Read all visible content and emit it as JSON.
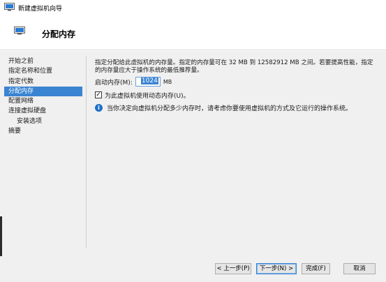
{
  "window": {
    "title": "新建虚拟机向导"
  },
  "header": {
    "title": "分配内存"
  },
  "nav": {
    "items": [
      {
        "label": "开始之前",
        "sub": false,
        "active": false
      },
      {
        "label": "指定名称和位置",
        "sub": false,
        "active": false
      },
      {
        "label": "指定代数",
        "sub": false,
        "active": false
      },
      {
        "label": "分配内存",
        "sub": false,
        "active": true
      },
      {
        "label": "配置网络",
        "sub": false,
        "active": false
      },
      {
        "label": "连接虚拟硬盘",
        "sub": false,
        "active": false
      },
      {
        "label": "安装选项",
        "sub": true,
        "active": false
      },
      {
        "label": "摘要",
        "sub": false,
        "active": false
      }
    ]
  },
  "content": {
    "description": "指定分配给此虚拟机的内存量。指定的内存量可在 32 MB 到 12582912 MB 之间。若要提高性能，指定的内存量应大于操作系统的最低推荐量。",
    "startup_memory_label": "启动内存(M):",
    "startup_memory_value": "1024",
    "startup_memory_unit": "MB",
    "dynamic_memory_label": "为此虚拟机使用动态内存(U)。",
    "dynamic_memory_checked": true,
    "info_text": "当你决定向虚拟机分配多少内存时，请考虑你要使用虚拟机的方式及它运行的操作系统。"
  },
  "footer": {
    "prev": "< 上一步(P)",
    "next": "下一步(N) >",
    "finish": "完成(F)",
    "cancel": "取消"
  },
  "colors": {
    "accent": "#3a84d2",
    "panel": "#f0f0f0",
    "info": "#1f6fc6"
  }
}
